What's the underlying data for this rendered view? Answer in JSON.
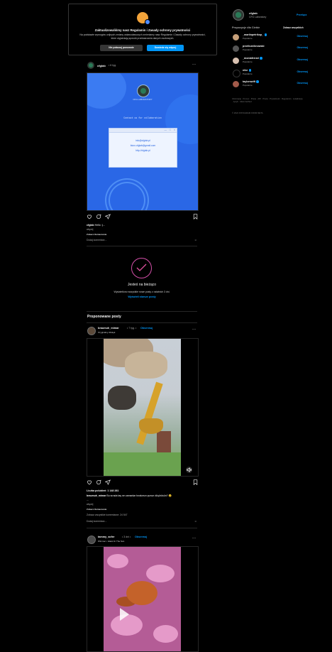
{
  "privacy_banner": {
    "title": "Zaktualizowaliśmy nasz Regulamin i Zasady ochrony prywatności",
    "description": "Na podstawie wymogów unijnych zmiany ustawodawczych zmieniamy nasz Regulamin i Zasady ochrony prywatności, które wyjaśniają sposób przetwarzania danych osobowych.",
    "dismiss_label": "Nie pokazuj ponownie",
    "learn_more_label": "Dowiedz się więcej"
  },
  "post1": {
    "username": "cfglab",
    "time": "• 6 tyg.",
    "image": {
      "brand": "CFG LABORATORY",
      "contact_line": "Contact us for collaboration",
      "lines": [
        "info@cfglab.pl",
        "biuro.cfglab@gmail.com",
        "http://cfglab.pl"
      ]
    },
    "caption_user": "cfglab",
    "caption_text": "Hello :)...",
    "more": "więcej",
    "translation": "Zobacz tłumaczenie",
    "add_comment": "Dodaj komentarz..."
  },
  "caught_up": {
    "title": "Jesteś na bieżąco",
    "subtitle": "Wyświetlono wszystkie nowe posty z ostatnich 3 dni.",
    "link": "Wyświetl starsze posty"
  },
  "suggested_header": "Proponowane posty",
  "post2": {
    "username": "braumuh_mimar",
    "time": "• 7 tyg. •",
    "follow": "Obserwuj",
    "audio": "Oryginalny dźwięk",
    "likes": "Liczba polubień: 1 148 281",
    "caption_user": "braumuh_mimar",
    "caption_text": "Bu sırada taş ne zamanlar bırakırsın şunun düşürüsün? 😮",
    "ellipsis": "...",
    "more": "więcej",
    "translation": "Zobacz tłumaczenie",
    "view_comments": "Zobacz wszystkie komentarze: 24 547",
    "add_comment": "Dodaj komentarz..."
  },
  "post3": {
    "username": "tammy_acfer",
    "time": "• 3 dni •",
    "follow": "Obserwuj",
    "audio": "Wimmer • Island In The Sun"
  },
  "sidebar": {
    "username": "cfglab",
    "fullname": "CFG Laboratory",
    "switch": "Przełącz",
    "suggestions_title": "Propozycje dla Ciebie",
    "see_all": "Zobacz wszystkich",
    "suggestions": [
      {
        "username": "_martinpetrikop_",
        "sub": "Popularne",
        "follow": "Obserwuj",
        "verified": true
      },
      {
        "username": "przeliczniknowski",
        "sub": "Popularne",
        "follow": "Obserwuj",
        "verified": false
      },
      {
        "username": "_moniaferrari",
        "sub": "Popularne",
        "follow": "Obserwuj",
        "verified": true
      },
      {
        "username": "nike",
        "sub": "Popularne",
        "follow": "Obserwuj",
        "verified": true
      },
      {
        "username": "taylorswift",
        "sub": "Popularne",
        "follow": "Obserwuj",
        "verified": true
      }
    ],
    "footer_links": "Informacje · Pomoc · Prasa · API · Praca · Prywatność · Regulamin · Lokalizacje · Język · Meta Verified",
    "copyright": "© 2024 INSTAGRAM FROM META"
  },
  "colors": {
    "accent": "#0095f6",
    "background": "#000000",
    "divider": "#262626"
  }
}
